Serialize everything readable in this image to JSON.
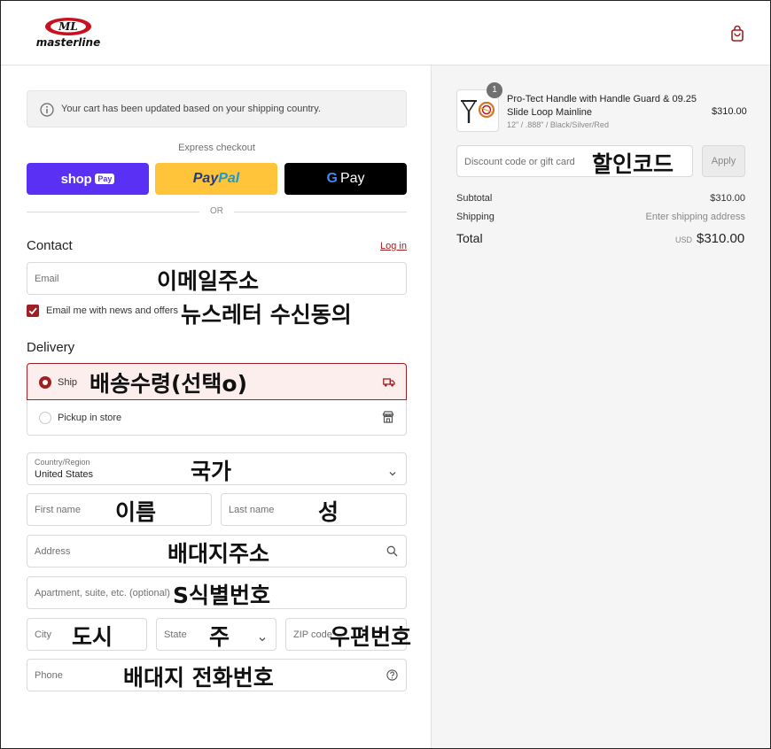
{
  "header": {
    "logo_text": "masterline",
    "logo_mark": "ML",
    "cart_icon": "shopping-bag-icon"
  },
  "notice": {
    "icon": "info-icon",
    "text": "Your cart has been updated based on your shipping country."
  },
  "express": {
    "label": "Express checkout",
    "shop_pay": {
      "word": "shop",
      "badge": "Pay"
    },
    "paypal": {
      "part1": "Pay",
      "part2": "Pal"
    },
    "gpay": {
      "g": "G",
      "word": "Pay"
    },
    "or": "OR"
  },
  "contact": {
    "title": "Contact",
    "login": "Log in",
    "email_placeholder": "Email",
    "email_overlay": "이메일주소",
    "newsletter_label": "Email me with news and offers",
    "newsletter_overlay": "뉴스레터 수신동의",
    "newsletter_checked": true
  },
  "delivery": {
    "title": "Delivery",
    "ship_label": "Ship",
    "ship_overlay": "배송수령(선택o)",
    "ship_icon": "truck-icon",
    "pickup_label": "Pickup in store",
    "pickup_icon": "store-icon",
    "country_label": "Country/Region",
    "country_value": "United States",
    "country_overlay": "국가",
    "first_name_placeholder": "First name",
    "first_name_overlay": "이름",
    "last_name_placeholder": "Last name",
    "last_name_overlay": "성",
    "address_placeholder": "Address",
    "address_overlay": "배대지주소",
    "apartment_placeholder": "Apartment, suite, etc. (optional)",
    "apartment_overlay": "S식별번호",
    "city_placeholder": "City",
    "city_overlay": "도시",
    "state_placeholder": "State",
    "state_overlay": "주",
    "zip_placeholder": "ZIP code",
    "zip_overlay": "우편번호",
    "phone_placeholder": "Phone",
    "phone_overlay": "배대지 전화번호"
  },
  "order": {
    "quantity": "1",
    "product_name": "Pro-Tect Handle with Handle Guard & 09.25 Slide Loop Mainline",
    "product_variant": "12\" / .888\" / Black/Silver/Red",
    "product_price": "$310.00",
    "discount_placeholder": "Discount code or gift card",
    "discount_overlay": "할인코드",
    "apply_label": "Apply",
    "subtotal_label": "Subtotal",
    "subtotal_value": "$310.00",
    "shipping_label": "Shipping",
    "shipping_value": "Enter shipping address",
    "total_label": "Total",
    "total_currency": "USD",
    "total_value": "$310.00",
    "accent_color": "#a01f24"
  }
}
